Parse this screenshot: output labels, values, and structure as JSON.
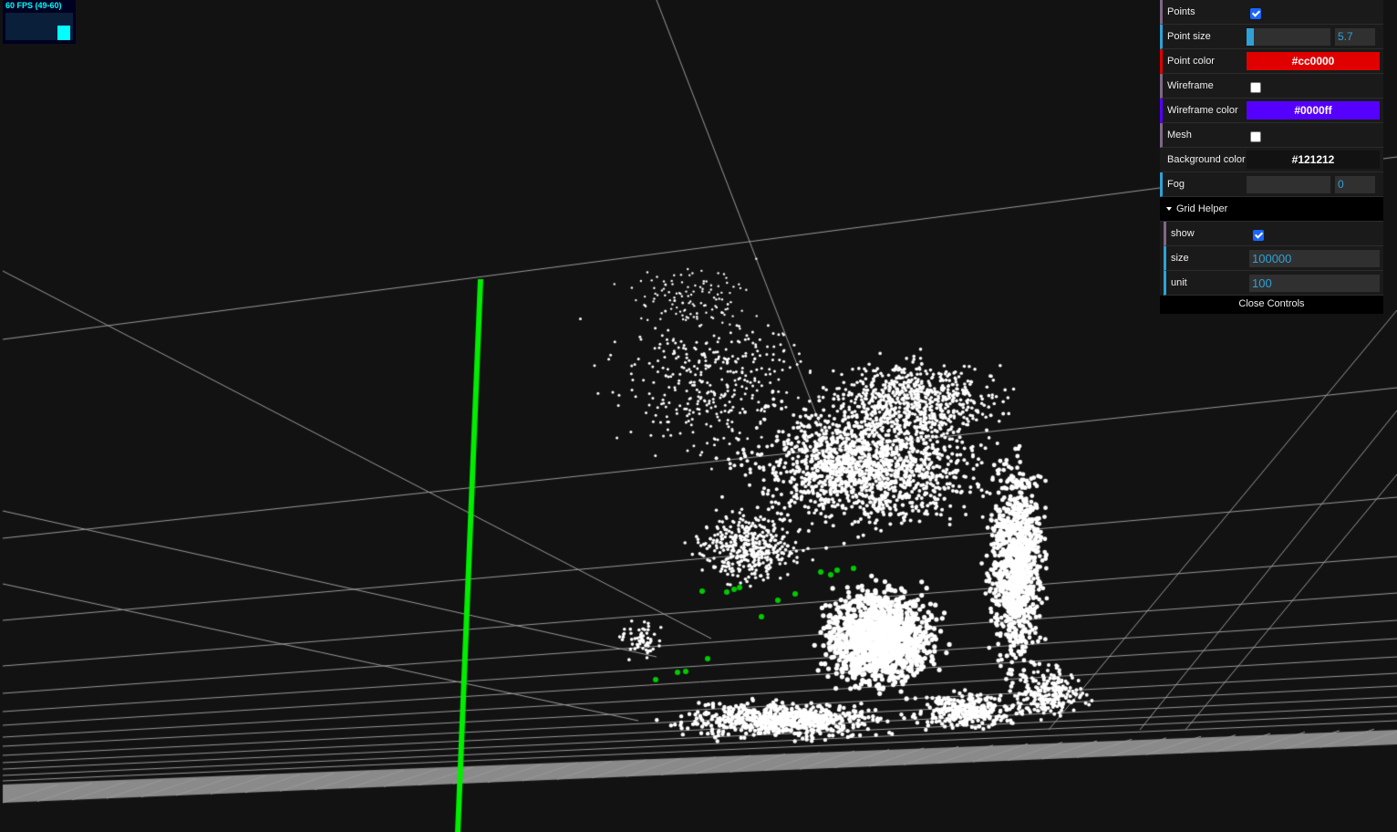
{
  "stats": {
    "fps_text": "60 FPS (49-60)",
    "fps_current": 60,
    "fps_min": 49,
    "fps_max": 60
  },
  "scene": {
    "background_color": "#121212",
    "grid_line_color": "#9a9a9a",
    "point_cloud_color": "#ffffff",
    "highlight_points_color": "#00cc00",
    "axis_color": "#00ee00"
  },
  "gui": {
    "points": {
      "label": "Points",
      "checked": true
    },
    "point_size": {
      "label": "Point size",
      "value": "5.7",
      "fraction": 0.09
    },
    "point_color": {
      "label": "Point color",
      "value": "#cc0000",
      "swatch": "#e00000"
    },
    "wireframe": {
      "label": "Wireframe",
      "checked": false
    },
    "wireframe_color": {
      "label": "Wireframe color",
      "value": "#0000ff",
      "swatch": "#5500ff"
    },
    "mesh": {
      "label": "Mesh",
      "checked": false
    },
    "background_color": {
      "label": "Background color",
      "value": "#121212",
      "swatch": "#121212"
    },
    "fog": {
      "label": "Fog",
      "value": "0",
      "fraction": 0
    },
    "grid_helper": {
      "title": "Grid Helper",
      "show": {
        "label": "show",
        "checked": true
      },
      "size": {
        "label": "size",
        "value": "100000"
      },
      "unit": {
        "label": "unit",
        "value": "100"
      }
    },
    "close_label": "Close Controls"
  }
}
